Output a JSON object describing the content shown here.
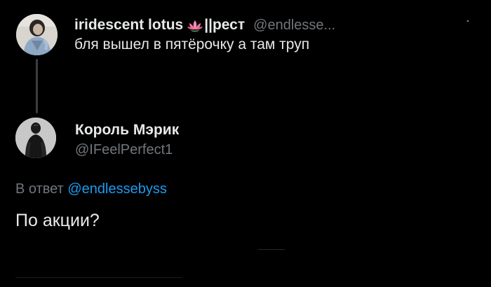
{
  "parent_tweet": {
    "display_name": "iridescent lotus",
    "name_emoji": "lotus-icon",
    "name_suffix": "||рест",
    "handle": "@endlesse...",
    "text": "бля вышел в пятёрочку а там труп"
  },
  "reply_tweet": {
    "display_name": "Король Мэрик",
    "handle": "@IFeelPerfect1",
    "reply_prefix": "В ответ",
    "reply_to": "@endlessebyss",
    "text": "По акции?"
  },
  "icons": {
    "more": "more-options-icon",
    "lotus": "lotus-icon"
  },
  "colors": {
    "background": "#000000",
    "primary_text": "#e7e9ea",
    "secondary_text": "#71767b",
    "accent": "#1d9bf0",
    "thread_line": "#3a3d41"
  }
}
